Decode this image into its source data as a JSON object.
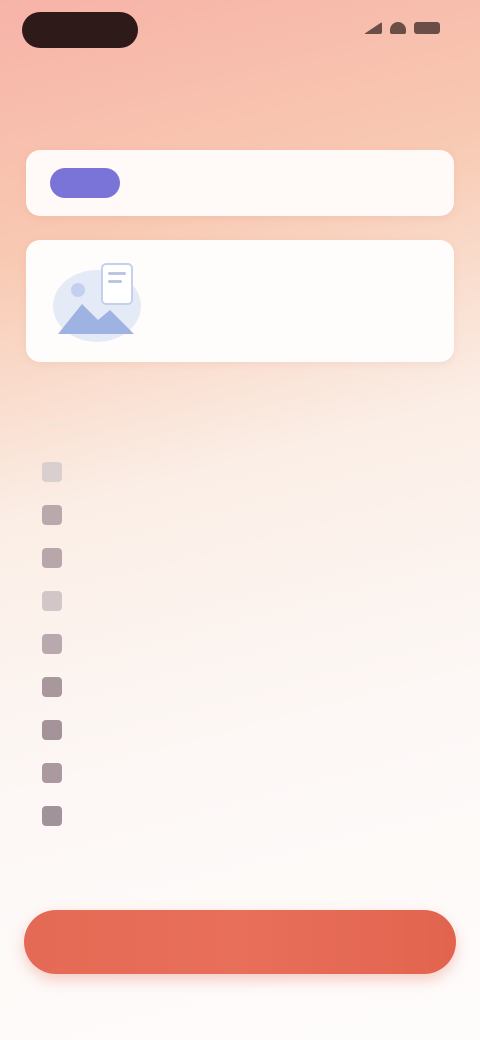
{
  "status_bar": {
    "time": "",
    "colors": {
      "pill": "#2e1a18"
    }
  },
  "search": {
    "badge_label": "",
    "placeholder": "",
    "badge_color": "#7b74d8"
  },
  "promo": {
    "title": "",
    "description": "",
    "illustration_icon": "document-illustration-icon"
  },
  "list": {
    "title": "",
    "count": "",
    "items": [
      {
        "label": "",
        "icon": "checkbox-icon",
        "icon_color": "#d9cfcf"
      },
      {
        "label": "",
        "icon": "document-icon",
        "icon_color": "#b9a9ad"
      },
      {
        "label": "",
        "icon": "document-icon",
        "icon_color": "#b8a6ab"
      },
      {
        "label": "",
        "icon": "checkbox-icon",
        "icon_color": "#d2c6c9"
      },
      {
        "label": "",
        "icon": "document-icon",
        "icon_color": "#b9a8ad"
      },
      {
        "label": "",
        "icon": "document-icon",
        "icon_color": "#a8979c"
      },
      {
        "label": "",
        "icon": "document-icon",
        "icon_color": "#a4949a"
      },
      {
        "label": "",
        "icon": "document-icon",
        "icon_color": "#aa999e"
      },
      {
        "label": "",
        "icon": "document-icon",
        "icon_color": "#a0939a"
      }
    ]
  },
  "cta": {
    "label": "",
    "color": "#e56a55"
  }
}
